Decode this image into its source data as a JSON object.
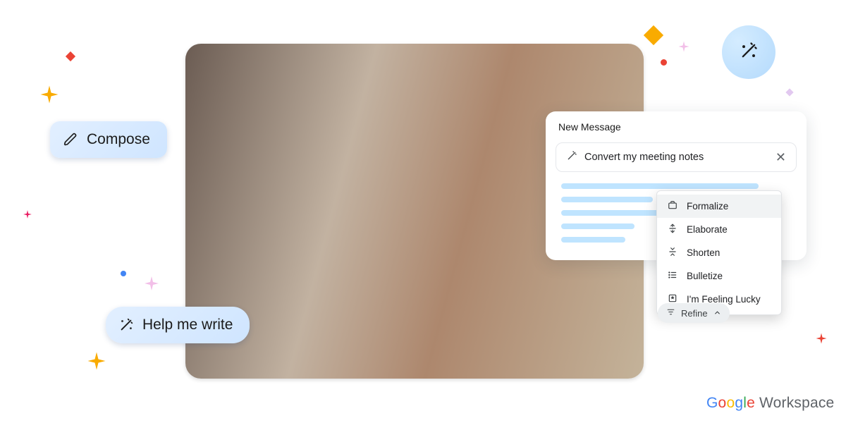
{
  "buttons": {
    "compose": "Compose",
    "help_me_write": "Help me write"
  },
  "panel": {
    "title": "New Message",
    "prompt": "Convert my meeting notes"
  },
  "menu": {
    "items": [
      {
        "label": "Formalize",
        "icon": "briefcase-icon"
      },
      {
        "label": "Elaborate",
        "icon": "expand-icon"
      },
      {
        "label": "Shorten",
        "icon": "compress-icon"
      },
      {
        "label": "Bulletize",
        "icon": "list-icon"
      },
      {
        "label": "I'm Feeling Lucky",
        "icon": "lucky-icon"
      }
    ]
  },
  "refine": {
    "label": "Refine"
  },
  "brand": {
    "google": "Google",
    "workspace": "Workspace"
  }
}
